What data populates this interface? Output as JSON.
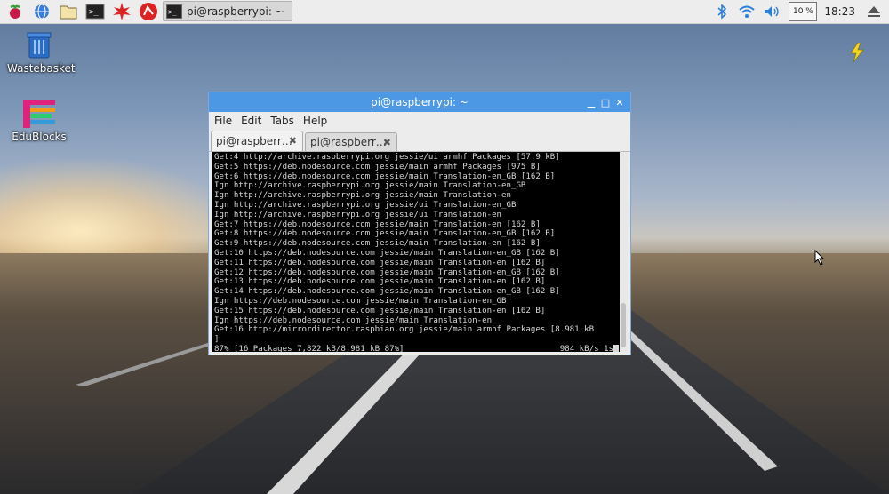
{
  "taskbar": {
    "launchers": [
      "raspberry-menu-icon",
      "web-browser-icon",
      "file-manager-icon",
      "terminal-icon",
      "mathematica-icon",
      "wolfram-icon"
    ],
    "task_button": "pi@raspberrypi: ~",
    "cpu_usage": "10 %",
    "clock": "18:23"
  },
  "desktop": {
    "icons": [
      {
        "label": "Wastebasket"
      },
      {
        "label": "EduBlocks"
      }
    ]
  },
  "terminal": {
    "title": "pi@raspberrypi: ~",
    "menu": [
      "File",
      "Edit",
      "Tabs",
      "Help"
    ],
    "tabs": [
      {
        "label": "pi@raspberr…",
        "active": true
      },
      {
        "label": "pi@raspberr…",
        "active": false
      }
    ],
    "lines": [
      "Get:4 http://archive.raspberrypi.org jessie/ui armhf Packages [57.9 kB]",
      "Get:5 https://deb.nodesource.com jessie/main armhf Packages [975 B]",
      "Get:6 https://deb.nodesource.com jessie/main Translation-en_GB [162 B]",
      "Ign http://archive.raspberrypi.org jessie/main Translation-en_GB",
      "Ign http://archive.raspberrypi.org jessie/main Translation-en",
      "Ign http://archive.raspberrypi.org jessie/ui Translation-en_GB",
      "Ign http://archive.raspberrypi.org jessie/ui Translation-en",
      "Get:7 https://deb.nodesource.com jessie/main Translation-en [162 B]",
      "Get:8 https://deb.nodesource.com jessie/main Translation-en_GB [162 B]",
      "Get:9 https://deb.nodesource.com jessie/main Translation-en [162 B]",
      "Get:10 https://deb.nodesource.com jessie/main Translation-en_GB [162 B]",
      "Get:11 https://deb.nodesource.com jessie/main Translation-en [162 B]",
      "Get:12 https://deb.nodesource.com jessie/main Translation-en_GB [162 B]",
      "Get:13 https://deb.nodesource.com jessie/main Translation-en [162 B]",
      "Get:14 https://deb.nodesource.com jessie/main Translation-en_GB [162 B]",
      "Ign https://deb.nodesource.com jessie/main Translation-en_GB",
      "Get:15 https://deb.nodesource.com jessie/main Translation-en [162 B]",
      "Ign https://deb.nodesource.com jessie/main Translation-en",
      "Get:16 http://mirrordirector.raspbian.org jessie/main armhf Packages [8.981 kB",
      "]"
    ],
    "status_left": "87% [16 Packages 7,822 kB/8,981 kB 87%]",
    "status_right": "984 kB/s 1s"
  },
  "colors": {
    "titlebar": "#4d98e4",
    "panel": "#ededed",
    "terminal_bg": "#000000"
  }
}
